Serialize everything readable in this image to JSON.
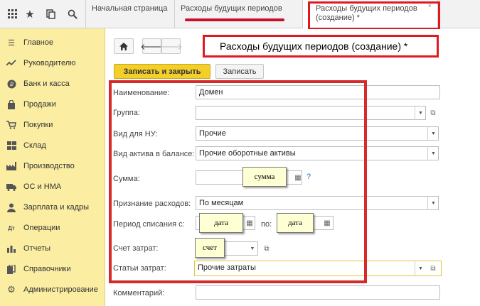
{
  "topbar": {
    "icons": [
      "apps-grid-icon",
      "star-icon",
      "history-icon",
      "search-icon"
    ],
    "tabs": [
      {
        "label": "Начальная страница"
      },
      {
        "label": "Расходы будущих периодов"
      },
      {
        "label": "Расходы будущих периодов (создание) *"
      }
    ]
  },
  "sidebar": {
    "items": [
      {
        "label": "Главное",
        "icon": "menu-lines-icon"
      },
      {
        "label": "Руководителю",
        "icon": "trend-icon"
      },
      {
        "label": "Банк и касса",
        "icon": "coin-icon"
      },
      {
        "label": "Продажи",
        "icon": "bag-icon"
      },
      {
        "label": "Покупки",
        "icon": "cart-icon"
      },
      {
        "label": "Склад",
        "icon": "warehouse-icon"
      },
      {
        "label": "Производство",
        "icon": "factory-icon"
      },
      {
        "label": "ОС и НМА",
        "icon": "truck-icon"
      },
      {
        "label": "Зарплата и кадры",
        "icon": "person-icon"
      },
      {
        "label": "Операции",
        "icon": "dt-kt-icon"
      },
      {
        "label": "Отчеты",
        "icon": "chart-icon"
      },
      {
        "label": "Справочники",
        "icon": "book-icon"
      },
      {
        "label": "Администрирование",
        "icon": "gear-icon"
      }
    ]
  },
  "form": {
    "title": "Расходы будущих периодов (создание) *",
    "save_close_label": "Записать и закрыть",
    "save_label": "Записать",
    "fields": {
      "name": {
        "label": "Наименование:",
        "value": "Домен"
      },
      "group": {
        "label": "Группа:",
        "value": ""
      },
      "nu_kind": {
        "label": "Вид для НУ:",
        "value": "Прочие"
      },
      "asset_kind": {
        "label": "Вид актива в балансе:",
        "value": "Прочие оборотные активы"
      },
      "sum": {
        "label": "Сумма:",
        "value": "",
        "help": "?"
      },
      "recognition": {
        "label": "Признание расходов:",
        "value": "По месяцам"
      },
      "period": {
        "label": "Период списания с:",
        "to_label": "по:"
      },
      "cost_account": {
        "label": "Счет затрат:",
        "value": ""
      },
      "cost_items": {
        "label": "Статьи затрат:",
        "value": "Прочие затраты"
      },
      "comment": {
        "label": "Комментарий:",
        "value": ""
      }
    },
    "stickers": {
      "sum": "сумма",
      "date_from": "дата",
      "date_to": "дата",
      "account": "счет"
    }
  }
}
